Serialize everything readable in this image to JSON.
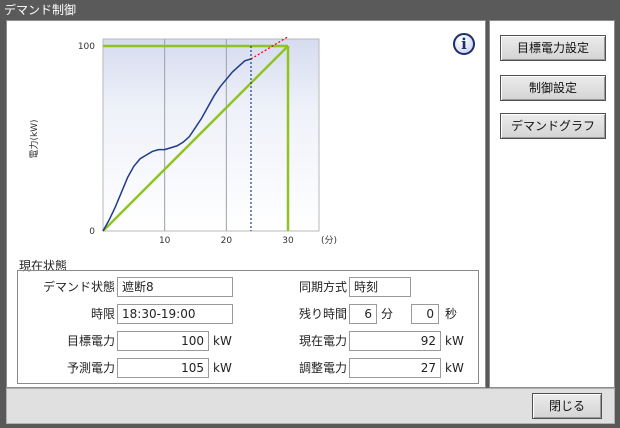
{
  "window": {
    "title": "デマンド制御"
  },
  "side_buttons": [
    {
      "label": "目標電力設定"
    },
    {
      "label": "制御設定"
    },
    {
      "label": "デマンドグラフ"
    }
  ],
  "close_button": {
    "label": "閉じる"
  },
  "info_icon": {
    "glyph": "i"
  },
  "status": {
    "section_title": "現在状態",
    "demand_state": {
      "label": "デマンド状態",
      "value": "遮断8"
    },
    "sync_mode": {
      "label": "同期方式",
      "value": "時刻"
    },
    "time_slot": {
      "label": "時限",
      "value": "18:30-19:00"
    },
    "remaining": {
      "label": "残り時間",
      "minutes": "6",
      "minutes_unit": "分",
      "seconds": "0",
      "seconds_unit": "秒"
    },
    "target_power": {
      "label": "目標電力",
      "value": "100",
      "unit": "kW"
    },
    "current_power": {
      "label": "現在電力",
      "value": "92",
      "unit": "kW"
    },
    "predicted_power": {
      "label": "予測電力",
      "value": "105",
      "unit": "kW"
    },
    "adjust_power": {
      "label": "調整電力",
      "value": "27",
      "unit": "kW"
    }
  },
  "colors": {
    "target_line": "#8fc31f",
    "actual_line": "#1f3c88",
    "prediction_line": "#e60000",
    "now_line": "#1f3c88"
  },
  "chart_data": {
    "type": "line",
    "ylabel": "電力(kW)",
    "xunit": "(分)",
    "xlim": [
      0,
      30
    ],
    "ylim": [
      0,
      100
    ],
    "x_ticks": [
      10,
      20,
      30
    ],
    "y_ticks": [
      0,
      100
    ],
    "grid": true,
    "now_minute": 24,
    "series": [
      {
        "role": "actual",
        "x": [
          0,
          1,
          2,
          3,
          4,
          5,
          6,
          7,
          8,
          9,
          10,
          11,
          12,
          13,
          14,
          15,
          16,
          17,
          18,
          19,
          20,
          21,
          22,
          23,
          24
        ],
        "values": [
          0,
          6,
          13,
          21,
          29,
          35,
          39,
          41,
          43,
          44,
          44,
          45,
          46,
          48,
          51,
          56,
          61,
          67,
          73,
          78,
          82,
          86,
          89,
          92,
          93
        ]
      },
      {
        "role": "prediction",
        "x": [
          24,
          30
        ],
        "values": [
          93,
          105
        ]
      },
      {
        "role": "target-ramp",
        "x": [
          0,
          30
        ],
        "values": [
          0,
          100
        ]
      },
      {
        "role": "target-limit",
        "x": [
          0,
          30
        ],
        "values": [
          100,
          100
        ]
      },
      {
        "role": "period-end",
        "x": [
          30,
          30
        ],
        "values": [
          100,
          0
        ]
      }
    ]
  }
}
